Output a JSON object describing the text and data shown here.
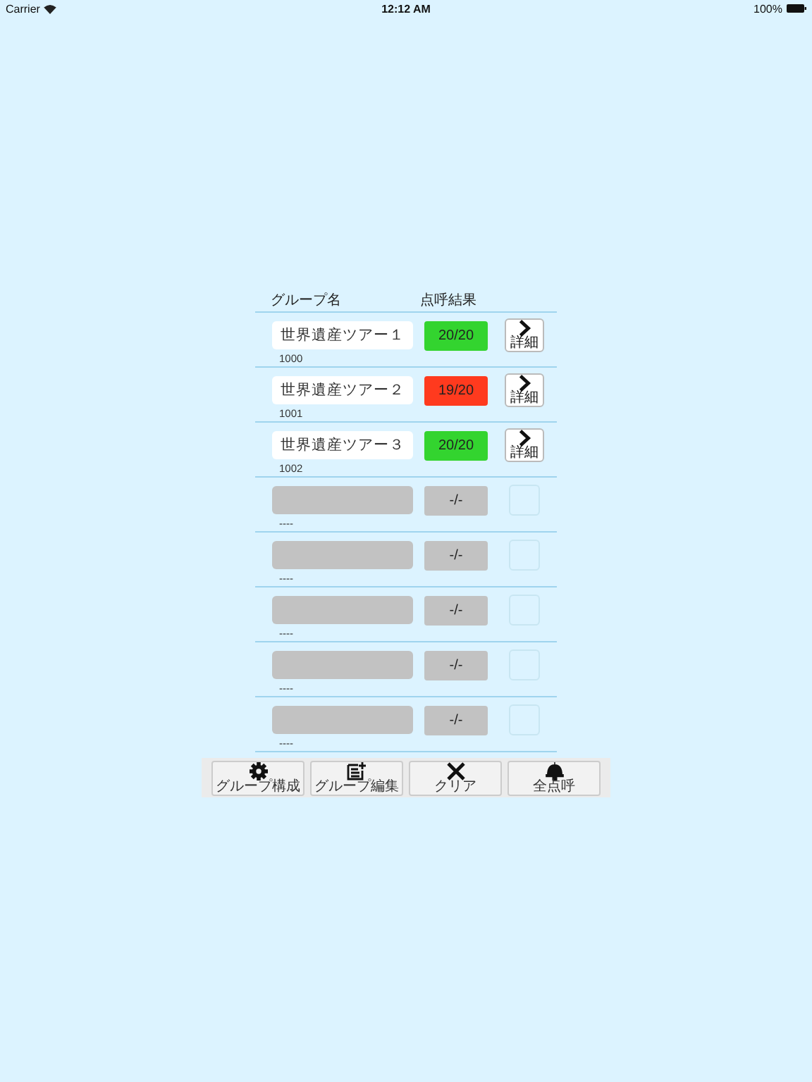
{
  "status_bar": {
    "carrier": "Carrier",
    "time": "12:12 AM",
    "battery": "100%"
  },
  "table": {
    "columns": [
      "グループ名",
      "点呼結果"
    ],
    "rows": [
      {
        "kind": "group",
        "name": "世界遺産ツアー１",
        "id": "1000",
        "result": "20/20",
        "color": "#33d42f",
        "detail": "詳細"
      },
      {
        "kind": "group",
        "name": "世界遺産ツアー２",
        "id": "1001",
        "result": "19/20",
        "color": "#ff3a1e",
        "detail": "詳細"
      },
      {
        "kind": "group",
        "name": "世界遺産ツアー３",
        "id": "1002",
        "result": "20/20",
        "color": "#33d42f",
        "detail": "詳細"
      },
      {
        "kind": "empty",
        "id": "----",
        "result": "-/-",
        "color": "#c2c2c2"
      },
      {
        "kind": "empty",
        "id": "----",
        "result": "-/-",
        "color": "#c2c2c2"
      },
      {
        "kind": "empty",
        "id": "----",
        "result": "-/-",
        "color": "#c2c2c2"
      },
      {
        "kind": "empty",
        "id": "----",
        "result": "-/-",
        "color": "#c2c2c2"
      },
      {
        "kind": "empty",
        "id": "----",
        "result": "-/-",
        "color": "#c2c2c2"
      }
    ]
  },
  "toolbar": [
    {
      "kind": "gear",
      "label": "グループ構成"
    },
    {
      "kind": "edit",
      "label": "グループ編集"
    },
    {
      "kind": "clear",
      "label": "クリア"
    },
    {
      "kind": "bell",
      "label": "全点呼"
    }
  ]
}
